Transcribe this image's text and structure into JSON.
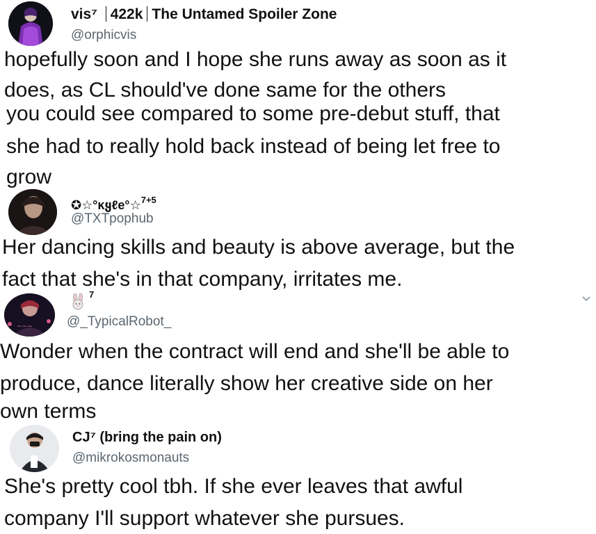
{
  "tweets": [
    {
      "name": "vis⁷",
      "name_extra": "422k",
      "name_zone": "The Untamed Spoiler Zone",
      "handle": "@orphicvis",
      "lines": [
        "hopefully soon and I hope she runs away as soon as it",
        "does, as CL should've done same for the others"
      ]
    },
    {
      "lines": [
        "you could see compared to some pre-debut stuff, that",
        "she had to really hold back instead of being let free to",
        "grow"
      ]
    },
    {
      "name": "✪☆°ĸყℓe°☆",
      "name_sup": "7+5",
      "handle": "@TXTpophub",
      "lines": [
        "Her dancing skills and beauty is above average, but the",
        "fact that she's in that company, irritates me."
      ]
    },
    {
      "name_sup": "7",
      "handle": "@_TypicalRobot_",
      "lines": [
        "Wonder when the contract will end and she'll be able to",
        "produce, dance literally show her creative side on her",
        "own terms"
      ]
    },
    {
      "name": "CJ⁷ (bring the pain on)",
      "handle": "@mikrokosmonauts",
      "lines": [
        "She's pretty cool tbh. If she ever leaves that awful",
        "company I'll support whatever she pursues."
      ]
    }
  ]
}
